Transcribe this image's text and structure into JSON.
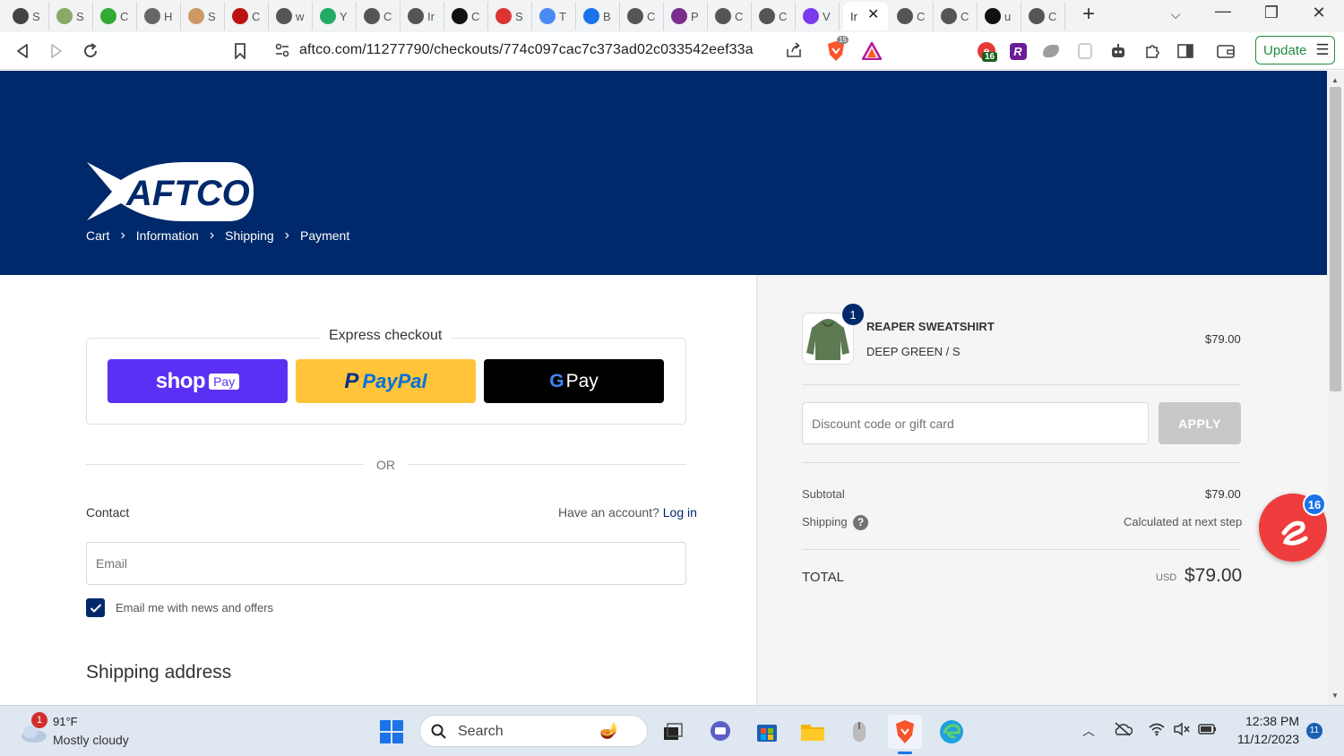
{
  "browser": {
    "tabs": [
      {
        "letter": "S",
        "color": "#444"
      },
      {
        "letter": "S",
        "color": "#8a6"
      },
      {
        "letter": "C",
        "color": "#3a3"
      },
      {
        "letter": "H",
        "color": "#666"
      },
      {
        "letter": "S",
        "color": "#c96"
      },
      {
        "letter": "C",
        "color": "#b11"
      },
      {
        "letter": "w",
        "color": "#555"
      },
      {
        "letter": "Y",
        "color": "#2a6"
      },
      {
        "letter": "C",
        "color": "#555"
      },
      {
        "letter": "Ir",
        "color": "#555"
      },
      {
        "letter": "C",
        "color": "#111"
      },
      {
        "letter": "S",
        "color": "#d33"
      },
      {
        "letter": "T",
        "color": "#4a8af4"
      },
      {
        "letter": "B",
        "color": "#1a73e8"
      },
      {
        "letter": "C",
        "color": "#555"
      },
      {
        "letter": "P",
        "color": "#7b2d8e"
      },
      {
        "letter": "C",
        "color": "#555"
      },
      {
        "letter": "C",
        "color": "#555"
      },
      {
        "letter": "V",
        "color": "#7c3aed"
      }
    ],
    "active_tab_label": "Ir",
    "tabs_after": [
      {
        "letter": "C",
        "color": "#555"
      },
      {
        "letter": "C",
        "color": "#555"
      },
      {
        "letter": "u",
        "color": "#111"
      },
      {
        "letter": "C",
        "color": "#555"
      }
    ],
    "url": "aftco.com/11277790/checkouts/774c097cac7c373ad02c033542eef33a",
    "update_label": "Update",
    "brave_badge": "15",
    "ext_badge": "16"
  },
  "checkout": {
    "logo_text": "AFTCO",
    "breadcrumb": [
      "Cart",
      "Information",
      "Shipping",
      "Payment"
    ],
    "express_label": "Express checkout",
    "shop_label": "shop",
    "shop_pay_badge": "Pay",
    "paypal_label": "PayPal",
    "gpay_g": "G",
    "gpay_label": "Pay",
    "or_label": "OR",
    "contact_label": "Contact",
    "account_prompt": "Have an account?",
    "login_label": "Log in",
    "email_placeholder": "Email",
    "news_label": "Email me with news and offers",
    "shipping_heading": "Shipping address"
  },
  "summary": {
    "qty": "1",
    "product_name": "REAPER SWEATSHIRT",
    "variant": "DEEP GREEN / S",
    "price": "$79.00",
    "discount_placeholder": "Discount code or gift card",
    "apply_label": "APPLY",
    "subtotal_label": "Subtotal",
    "subtotal_value": "$79.00",
    "shipping_label": "Shipping",
    "shipping_value": "Calculated at next step",
    "total_label": "TOTAL",
    "currency": "USD",
    "total_value": "$79.00"
  },
  "widget": {
    "badge": "16"
  },
  "taskbar": {
    "weather_badge": "1",
    "temp": "91°F",
    "condition": "Mostly cloudy",
    "search_placeholder": "Search",
    "time": "12:38 PM",
    "date": "11/12/2023",
    "notif_count": "11"
  }
}
